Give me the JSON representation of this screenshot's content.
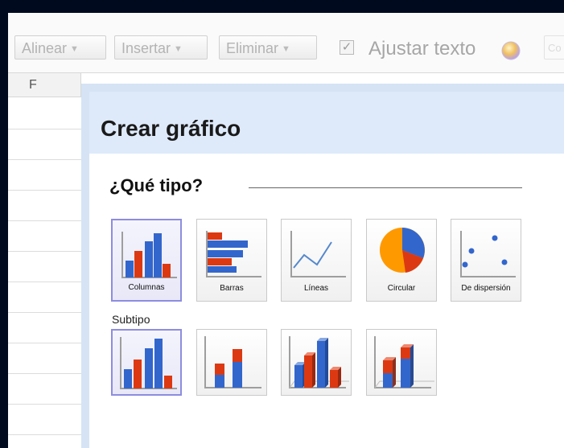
{
  "toolbar": {
    "align_label": "Alinear",
    "insert_label": "Insertar",
    "delete_label": "Eliminar",
    "wrap_text_label": "Ajustar texto",
    "wrap_text_checked": true,
    "truncated_label": "Co"
  },
  "sheet": {
    "column_letter": "F"
  },
  "dialog": {
    "title": "Crear gráfico",
    "type_heading": "¿Qué tipo?",
    "chart_types": [
      {
        "label": "Columnas",
        "icon": "column-chart-icon",
        "selected": true
      },
      {
        "label": "Barras",
        "icon": "bar-chart-icon",
        "selected": false
      },
      {
        "label": "Líneas",
        "icon": "line-chart-icon",
        "selected": false
      },
      {
        "label": "Circular",
        "icon": "pie-chart-icon",
        "selected": false
      },
      {
        "label": "De dispersión",
        "icon": "scatter-chart-icon",
        "selected": false
      }
    ],
    "subtype_label": "Subtipo",
    "subtypes": [
      {
        "icon": "clustered-column-icon",
        "selected": true
      },
      {
        "icon": "stacked-column-icon",
        "selected": false
      },
      {
        "icon": "3d-clustered-column-icon",
        "selected": false
      },
      {
        "icon": "3d-stacked-column-icon",
        "selected": false
      }
    ]
  },
  "colors": {
    "chart_red": "#dc3912",
    "chart_blue": "#3366cc",
    "chart_orange": "#ff9900",
    "selection_border": "#8d8de0",
    "dialog_header": "#deeafa"
  }
}
